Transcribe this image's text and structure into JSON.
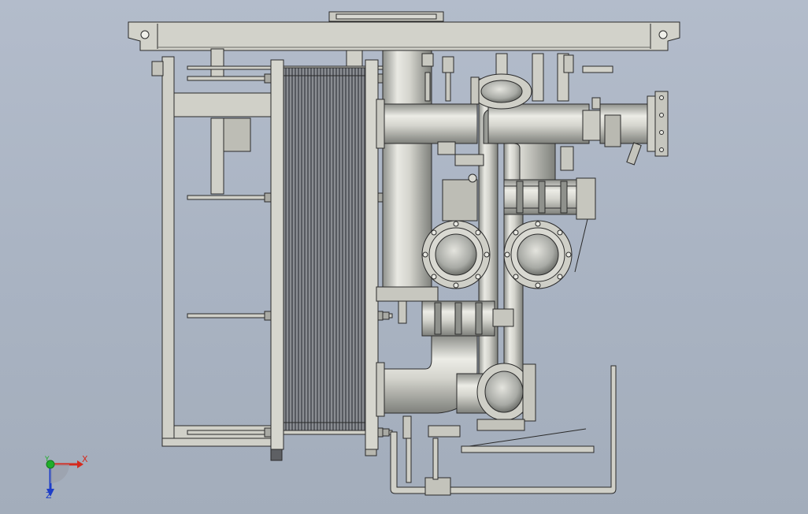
{
  "triad": {
    "x_label": "X",
    "y_label": "Y",
    "z_label": "Z",
    "x_color": "#d42a1e",
    "y_color": "#1fae2a",
    "z_color": "#1e3ec8"
  },
  "colors": {
    "background": "#aab4c3",
    "steel_fill": "#cfcfc6",
    "pipe_light": "#e8e8e2",
    "pipe_dark": "#8f918c",
    "line": "#2a2a2a",
    "plate_pack": "#4a4d52"
  }
}
